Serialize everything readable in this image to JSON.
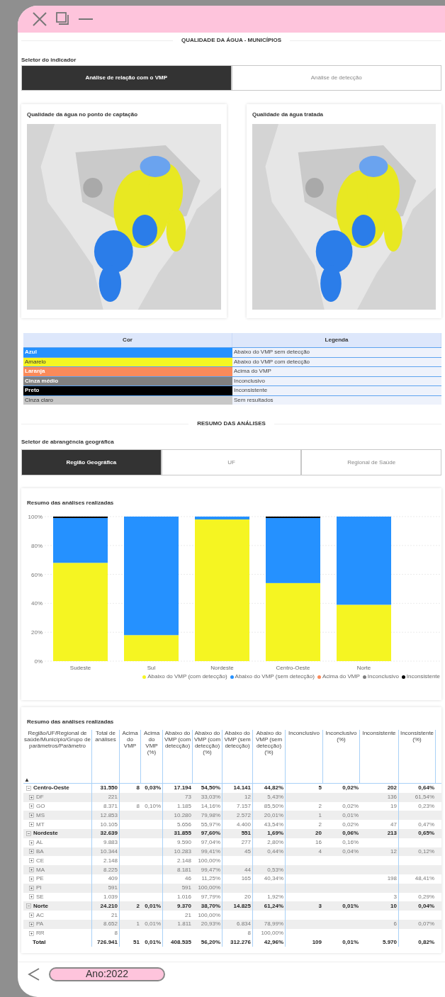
{
  "window": {
    "title": "QUALIDADE DA ÁGUA - MUNICÍPIOS"
  },
  "indicator_selector": {
    "label": "Seletor do indicador",
    "tabs": [
      {
        "label": "Análise de relação com o VMP",
        "selected": true
      },
      {
        "label": "Análise de detecção",
        "selected": false
      }
    ]
  },
  "maps": [
    {
      "title": "Qualidade da água no ponto de captação",
      "kind": "picture"
    },
    {
      "title": "Qualidade da água tratada",
      "kind": "picture"
    }
  ],
  "legend_table": {
    "columns": [
      "Cor",
      "Legenda"
    ],
    "rows": [
      {
        "color_name": "Azul",
        "color": "#2591ff",
        "legend": "Abaixo do VMP sem detecção"
      },
      {
        "color_name": "Amarelo",
        "color": "#f5f522",
        "legend": "Abaixo do VMP com detecção"
      },
      {
        "color_name": "Laranja",
        "color": "#fa8a5a",
        "legend": "Acima do VMP"
      },
      {
        "color_name": "Cinza médio",
        "color": "#808080",
        "legend": "Inconclusivo"
      },
      {
        "color_name": "Preto",
        "color": "#000000",
        "legend": "Inconsistente"
      },
      {
        "color_name": "Cinza claro",
        "color": "#c8c8c8",
        "legend": "Sem resultados"
      }
    ]
  },
  "summary_section": {
    "title": "RESUMO DAS ANÁLISES"
  },
  "geo_selector": {
    "label": "Seletor de abrangência geográfica",
    "tabs": [
      {
        "label": "Região Geográfica",
        "selected": true
      },
      {
        "label": "UF",
        "selected": false
      },
      {
        "label": "Regional de Saúde",
        "selected": false
      }
    ]
  },
  "chart_card": {
    "title": "Resumo das análises realizadas",
    "chart_data": {
      "type": "bar",
      "stacked": true,
      "orientation": "vertical",
      "grid": true,
      "legend": true,
      "categories": [
        "Sudeste",
        "Sul",
        "Nordeste",
        "Centro-Oeste",
        "Norte"
      ],
      "ylim": [
        0,
        100
      ],
      "yticks": [
        {
          "value": 0,
          "label": "0%"
        },
        {
          "value": 20,
          "label": "20%"
        },
        {
          "value": 40,
          "label": "40%"
        },
        {
          "value": 60,
          "label": "60%"
        },
        {
          "value": 80,
          "label": "80%"
        },
        {
          "value": 100,
          "label": "100%"
        }
      ],
      "series": [
        {
          "name": "Abaixo do VMP (com detecção)",
          "color": "#f5f522",
          "values": [
            68,
            18,
            98,
            54,
            39
          ]
        },
        {
          "name": "Abaixo do VMP (sem detecção)",
          "color": "#2591ff",
          "values": [
            31,
            82,
            2,
            45,
            61
          ]
        },
        {
          "name": "Acima do VMP",
          "color": "#fa8a5a",
          "values": [
            0,
            0,
            0,
            0,
            0
          ]
        },
        {
          "name": "Inconclusivo",
          "color": "#808080",
          "values": [
            0,
            0,
            0,
            0,
            0
          ]
        },
        {
          "name": "Inconsistente",
          "color": "#000000",
          "values": [
            1,
            0,
            0,
            1,
            0
          ]
        }
      ]
    }
  },
  "table_card": {
    "title": "Resumo das análises realizadas",
    "sort_mark": "▲",
    "columns": [
      "Região/UF/Regional de saúde/Município/Grupo de parâmetros/Parâmetro",
      "Total de análises",
      "Acima do VMP",
      "Acima do VMP (%)",
      "Abaixo do VMP (com detecção)",
      "Abaixo do VMP (com detecção) (%)",
      "Abaixo do VMP (sem detecção)",
      "Abaixo do VMP (sem detecção) (%)",
      "Inconclusivo",
      "Inconclusivo (%)",
      "Inconsistente",
      "Inconsistente (%)"
    ],
    "rows": [
      {
        "kind": "group",
        "expanded": true,
        "cells": [
          "Centro-Oeste",
          "31.550",
          "8",
          "0,03%",
          "17.194",
          "54,50%",
          "14.141",
          "44,82%",
          "5",
          "0,02%",
          "202",
          "0,64%"
        ]
      },
      {
        "kind": "item",
        "expanded": false,
        "cells": [
          "DF",
          "221",
          null,
          null,
          "73",
          "33,03%",
          "12",
          "5,43%",
          null,
          null,
          "136",
          "61,54%"
        ]
      },
      {
        "kind": "item",
        "expanded": false,
        "cells": [
          "GO",
          "8.371",
          "8",
          "0,10%",
          "1.185",
          "14,16%",
          "7.157",
          "85,50%",
          "2",
          "0,02%",
          "19",
          "0,23%"
        ]
      },
      {
        "kind": "item",
        "expanded": false,
        "cells": [
          "MS",
          "12.853",
          null,
          null,
          "10.280",
          "79,98%",
          "2.572",
          "20,01%",
          "1",
          "0,01%",
          null,
          null
        ]
      },
      {
        "kind": "item",
        "expanded": false,
        "cells": [
          "MT",
          "10.105",
          null,
          null,
          "5.656",
          "55,97%",
          "4.400",
          "43,54%",
          "2",
          "0,02%",
          "47",
          "0,47%"
        ]
      },
      {
        "kind": "group",
        "expanded": true,
        "cells": [
          "Nordeste",
          "32.639",
          null,
          null,
          "31.855",
          "97,60%",
          "551",
          "1,69%",
          "20",
          "0,06%",
          "213",
          "0,65%"
        ]
      },
      {
        "kind": "item",
        "expanded": false,
        "cells": [
          "AL",
          "9.883",
          null,
          null,
          "9.590",
          "97,04%",
          "277",
          "2,80%",
          "16",
          "0,16%",
          null,
          null
        ]
      },
      {
        "kind": "item",
        "expanded": false,
        "cells": [
          "BA",
          "10.344",
          null,
          null,
          "10.283",
          "99,41%",
          "45",
          "0,44%",
          "4",
          "0,04%",
          "12",
          "0,12%"
        ]
      },
      {
        "kind": "item",
        "expanded": false,
        "cells": [
          "CE",
          "2.148",
          null,
          null,
          "2.148",
          "100,00%",
          null,
          null,
          null,
          null,
          null,
          null
        ]
      },
      {
        "kind": "item",
        "expanded": false,
        "cells": [
          "MA",
          "8.225",
          null,
          null,
          "8.181",
          "99,47%",
          "44",
          "0,53%",
          null,
          null,
          null,
          null
        ]
      },
      {
        "kind": "item",
        "expanded": false,
        "cells": [
          "PE",
          "409",
          null,
          null,
          "46",
          "11,25%",
          "165",
          "40,34%",
          null,
          null,
          "198",
          "48,41%"
        ]
      },
      {
        "kind": "item",
        "expanded": false,
        "cells": [
          "PI",
          "591",
          null,
          null,
          "591",
          "100,00%",
          null,
          null,
          null,
          null,
          null,
          null
        ]
      },
      {
        "kind": "item",
        "expanded": false,
        "cells": [
          "SE",
          "1.039",
          null,
          null,
          "1.016",
          "97,79%",
          "20",
          "1,92%",
          null,
          null,
          "3",
          "0,29%"
        ]
      },
      {
        "kind": "group",
        "expanded": true,
        "cells": [
          "Norte",
          "24.210",
          "2",
          "0,01%",
          "9.370",
          "38,70%",
          "14.825",
          "61,24%",
          "3",
          "0,01%",
          "10",
          "0,04%"
        ]
      },
      {
        "kind": "item",
        "expanded": false,
        "cells": [
          "AC",
          "21",
          null,
          null,
          "21",
          "100,00%",
          null,
          null,
          null,
          null,
          null,
          null
        ]
      },
      {
        "kind": "item",
        "expanded": false,
        "cells": [
          "PA",
          "8.652",
          "1",
          "0,01%",
          "1.811",
          "20,93%",
          "6.834",
          "78,99%",
          null,
          null,
          "6",
          "0,07%"
        ]
      },
      {
        "kind": "item",
        "expanded": false,
        "cells": [
          "RR",
          "8",
          null,
          null,
          null,
          null,
          "8",
          "100,00%",
          null,
          null,
          null,
          null
        ]
      }
    ],
    "total": [
      "Total",
      "726.941",
      "51",
      "0,01%",
      "408.535",
      "56,20%",
      "312.276",
      "42,96%",
      "109",
      "0,01%",
      "5.970",
      "0,82%"
    ]
  },
  "footer": {
    "filter_pill": "Ano:2022"
  }
}
